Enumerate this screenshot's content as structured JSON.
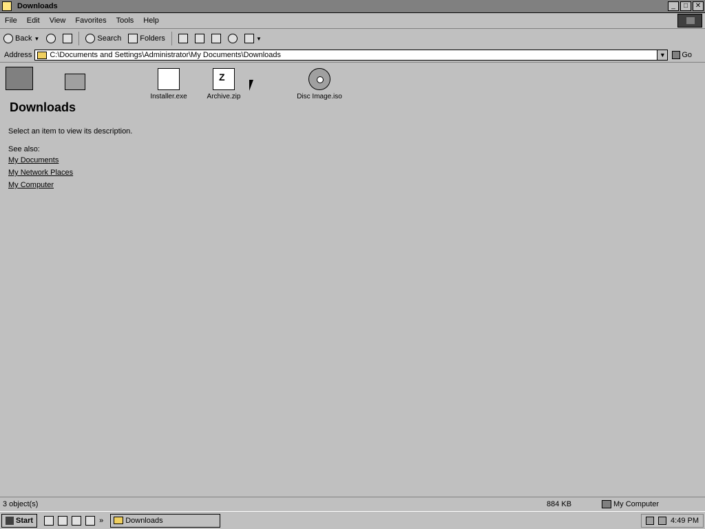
{
  "window": {
    "title": "Downloads"
  },
  "menu": [
    "File",
    "Edit",
    "View",
    "Favorites",
    "Tools",
    "Help"
  ],
  "toolbar": {
    "back": "Back",
    "search": "Search",
    "folders": "Folders"
  },
  "address": {
    "label": "Address",
    "value": "C:\\Documents and Settings\\Administrator\\My Documents\\Downloads",
    "go": "Go"
  },
  "folder_pane": {
    "title": "Downloads",
    "description": "Select an item to view its description.",
    "see_also": "See also:",
    "links": [
      "My Documents",
      "My Network Places",
      "My Computer"
    ]
  },
  "files": [
    {
      "name": "Installer.exe",
      "icon": "installer-icon"
    },
    {
      "name": "Archive.zip",
      "icon": "zip-icon"
    },
    {
      "name": "Disc Image.iso",
      "icon": "disc-icon"
    }
  ],
  "status": {
    "text": "3 object(s)",
    "size": "884 KB",
    "zone": "My Computer"
  },
  "taskbar": {
    "start": "Start",
    "task": "Downloads",
    "clock": "4:49 PM"
  }
}
